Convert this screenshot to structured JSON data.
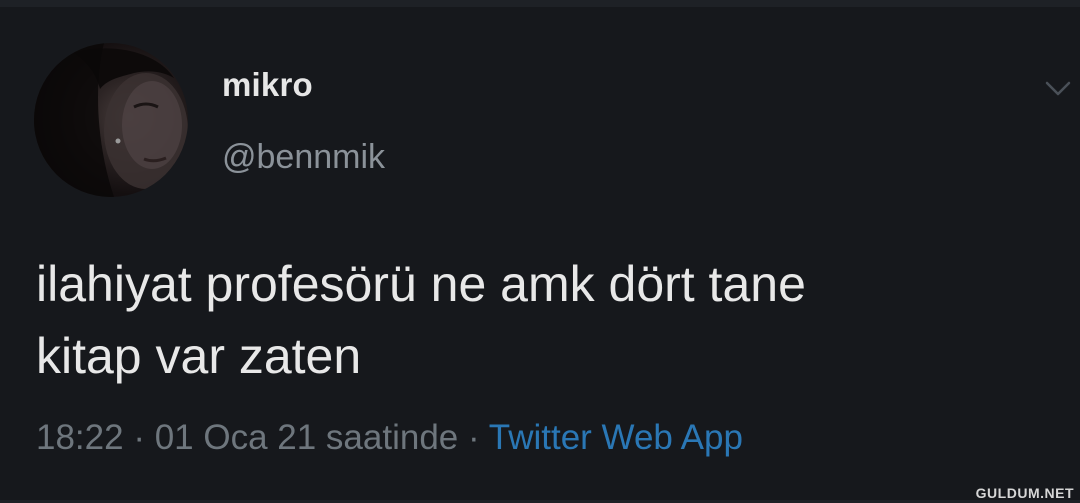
{
  "tweet": {
    "display_name": "mikro",
    "handle": "@bennmik",
    "text_lines": [
      "ilahiyat profesörü ne amk dört tane",
      "kitap var zaten"
    ],
    "time": "18:22",
    "separator": " · ",
    "date": "01 Oca 21 saatinde",
    "source": "Twitter Web App"
  },
  "icons": {
    "avatar": "user-avatar-photo",
    "more": "chevron-down-icon"
  },
  "watermark": "GULDUM.NET",
  "colors": {
    "background": "#16181c",
    "text_primary": "#e8e8e8",
    "text_secondary": "#6e767d",
    "link": "#2a77b5"
  }
}
